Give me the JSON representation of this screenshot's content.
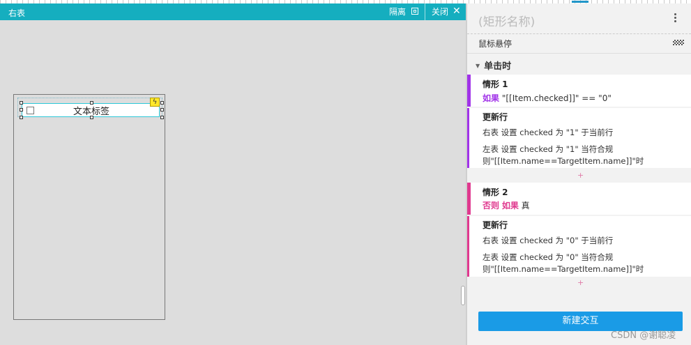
{
  "editor": {
    "title": "右表",
    "detach_label": "隔离",
    "close_label": "关闭",
    "close_icon": "✕",
    "row_label": "文本标签",
    "lightning_icon": "ϟ"
  },
  "panel": {
    "shape_name": "(矩形名称)",
    "events": {
      "hover": "鼠标悬停",
      "click": "单击时",
      "click_toggle": "▼"
    },
    "cases": [
      {
        "title": "情形 1",
        "cond_prefix": "",
        "cond_keyword": "如果",
        "cond_text": " \"[[Item.checked]]\" == \"0\"",
        "action_head": "更新行",
        "action_1": "右表 设置 checked 为 \"1\" 于当前行",
        "action_2a": "左表 设置 checked 为 \"1\" 当符合规",
        "action_2b": "则\"[[Item.name==TargetItem.name]]\"时",
        "accent": "#a133e8"
      },
      {
        "title": "情形 2",
        "cond_prefix": "否则",
        "cond_keyword": "如果",
        "cond_text": " 真",
        "action_head": "更新行",
        "action_1": "右表 设置 checked 为 \"0\" 于当前行",
        "action_2a": "左表 设置 checked 为 \"0\" 当符合规",
        "action_2b": "则\"[[Item.name==TargetItem.name]]\"时",
        "accent": "#e0398f"
      }
    ],
    "add_case_icon": "+",
    "new_interaction_label": "新建交互"
  },
  "watermark": "CSDN @谢聪凌",
  "colors": {
    "header": "#15aebf",
    "primary_button": "#1a9be6",
    "case1_accent": "#a133e8",
    "case2_accent": "#e0398f"
  }
}
